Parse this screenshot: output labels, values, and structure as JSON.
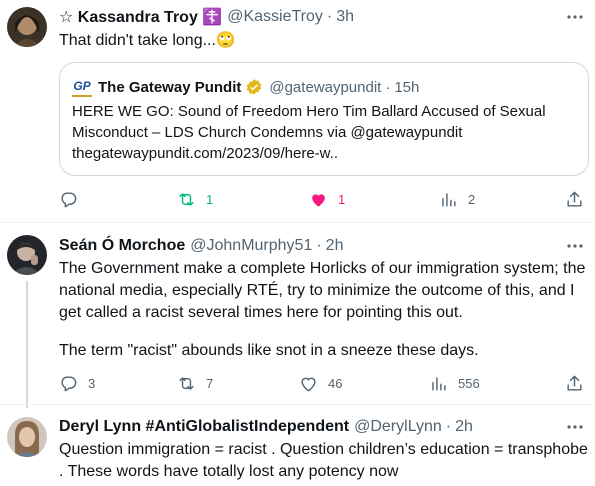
{
  "tweets": [
    {
      "name": "☆ Kassandra Troy ☦️",
      "handle": "@KassieTroy",
      "time": "3h",
      "text": "That didn't take long...🙄",
      "quote": {
        "logo": "GP",
        "name": "The Gateway Pundit",
        "handle": "@gatewaypundit",
        "time": "15h",
        "text": "HERE WE GO: Sound of Freedom Hero Tim Ballard Accused of Sexual Misconduct – LDS Church Condemns via @gatewaypundit thegatewaypundit.com/2023/09/here-w.."
      },
      "replies": "",
      "retweets": "1",
      "likes": "1",
      "views": "2"
    },
    {
      "name": "Seán Ó Morchoe",
      "handle": "@JohnMurphy51",
      "time": "2h",
      "text": "The Government make a complete Horlicks of our immigration system; the national media, especially RTÉ, try to minimize the outcome of this, and I get called a racist several times here for pointing this out.",
      "text2": "The term \"racist\" abounds like snot in a sneeze these days.",
      "replies": "3",
      "retweets": "7",
      "likes": "46",
      "views": "556"
    },
    {
      "name": "Deryl Lynn #AntiGlobalistIndependent",
      "handle": "@DerylLynn",
      "time": "2h",
      "text": "Question immigration = racist . Question children’s education = transphobe .  These words have totally lost any potency now"
    }
  ],
  "colors": {
    "like_active": "#f91880",
    "retweet_active": "#00ba7c",
    "secondary_text": "#536471",
    "verified_gold": "#e2b719"
  },
  "icons": [
    "more-icon",
    "reply-icon",
    "retweet-icon",
    "like-icon",
    "views-icon",
    "share-icon",
    "verified-gold-icon"
  ]
}
